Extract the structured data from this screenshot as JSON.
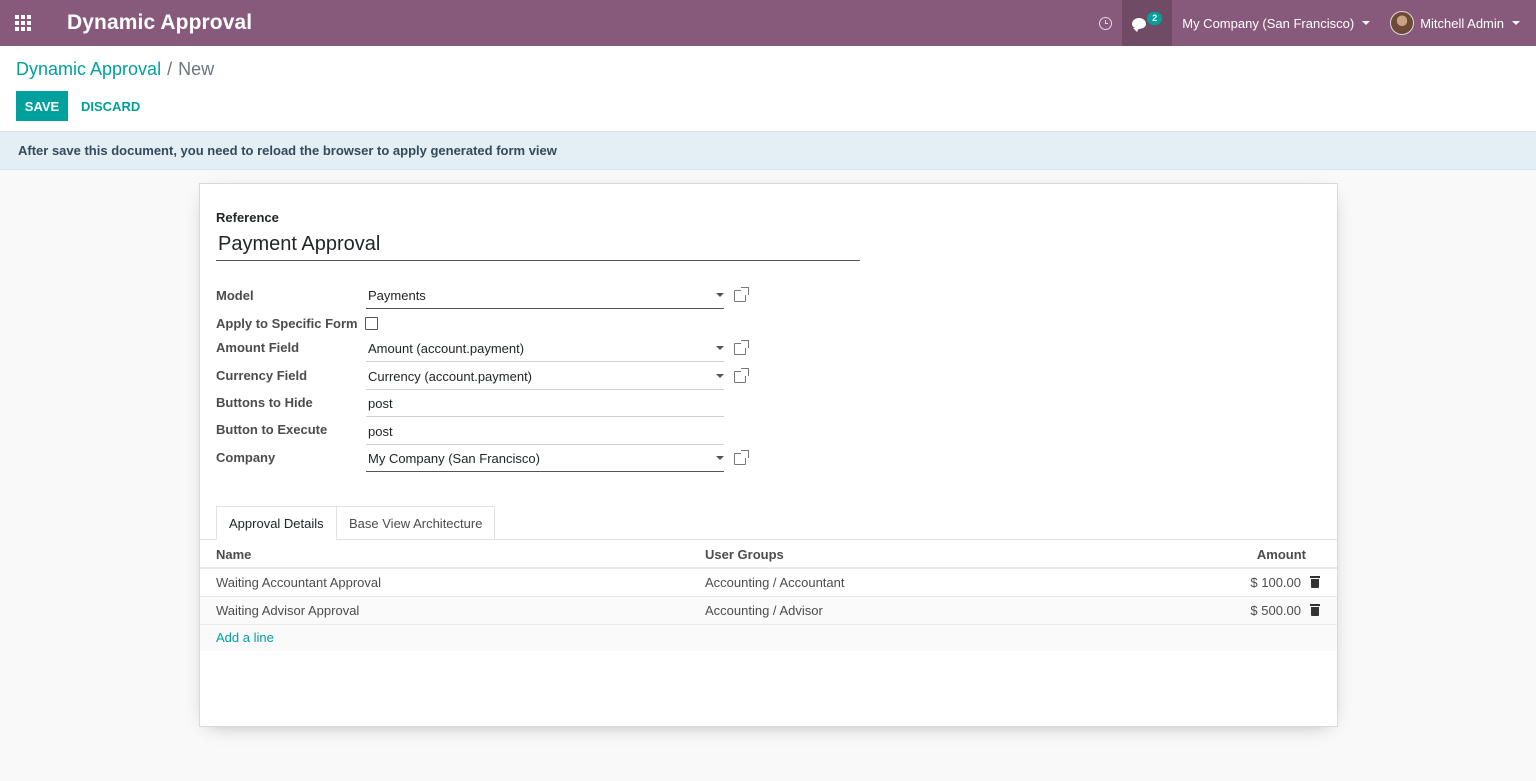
{
  "navbar": {
    "app_title": "Dynamic Approval",
    "chat_badge": "2",
    "company": "My Company (San Francisco)",
    "user": "Mitchell Admin"
  },
  "breadcrumb": {
    "parent": "Dynamic Approval",
    "separator": "/",
    "current": "New"
  },
  "buttons": {
    "save": "SAVE",
    "discard": "DISCARD"
  },
  "alert": "After save this document, you need to reload the browser to apply generated form view",
  "form": {
    "reference_label": "Reference",
    "reference_value": "Payment Approval",
    "fields": {
      "model": {
        "label": "Model",
        "value": "Payments"
      },
      "apply_specific": {
        "label": "Apply to Specific Form",
        "checked": false
      },
      "amount_field": {
        "label": "Amount Field",
        "value": "Amount (account.payment)"
      },
      "currency_field": {
        "label": "Currency Field",
        "value": "Currency (account.payment)"
      },
      "buttons_hide": {
        "label": "Buttons to Hide",
        "value": "post"
      },
      "button_execute": {
        "label": "Button to Execute",
        "value": "post"
      },
      "company": {
        "label": "Company",
        "value": "My Company (San Francisco)"
      }
    }
  },
  "tabs": [
    "Approval Details",
    "Base View Architecture"
  ],
  "table": {
    "headers": [
      "Name",
      "User Groups",
      "Amount"
    ],
    "rows": [
      [
        "Waiting Accountant Approval",
        "Accounting / Accountant",
        "$ 100.00"
      ],
      [
        "Waiting Advisor Approval",
        "Accounting / Advisor",
        "$ 500.00"
      ]
    ],
    "add_line": "Add a line"
  }
}
